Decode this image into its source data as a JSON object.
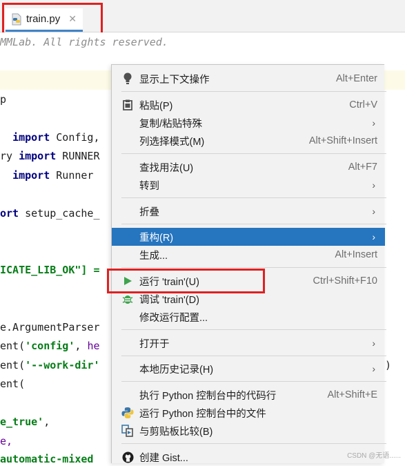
{
  "tab": {
    "filename": "train.py",
    "close_glyph": "✕"
  },
  "editor": {
    "lines": {
      "l1": "MMLab. All rights reserved.",
      "l3": "p",
      "l4a": "  ",
      "l4b": "import",
      "l4c": " Config,",
      "l5a": "ry ",
      "l5b": "import",
      "l5c": " RUNNER",
      "l6a": "  ",
      "l6b": "import",
      "l6c": " Runner",
      "l7a": "ort",
      "l7b": " setup_cache_",
      "l9": "ICATE_LIB_OK\"] =",
      "l11": "e.ArgumentParser",
      "l12a": "ent(",
      "l12b": "'config'",
      "l12c": ", ",
      "l12d": "he",
      "l13a": "ent(",
      "l13b": "'--work-dir'",
      "l13end": ")",
      "l14": "ent(",
      "l16a": "e_true'",
      "l16b": ",",
      "l17": "e,",
      "l18": "automatic-mixed"
    }
  },
  "menu": {
    "items": [
      {
        "label": "显示上下文操作",
        "shortcut": "Alt+Enter"
      },
      {
        "label": "粘贴(P)",
        "shortcut": "Ctrl+V"
      },
      {
        "label": "复制/粘贴特殊",
        "arrow": "›"
      },
      {
        "label": "列选择模式(M)",
        "shortcut": "Alt+Shift+Insert"
      },
      {
        "label": "查找用法(U)",
        "shortcut": "Alt+F7"
      },
      {
        "label": "转到",
        "arrow": "›"
      },
      {
        "label": "折叠",
        "arrow": "›"
      },
      {
        "label": "重构(R)",
        "arrow": "›"
      },
      {
        "label": "生成...",
        "shortcut": "Alt+Insert"
      },
      {
        "label": "运行 'train'(U)",
        "shortcut": "Ctrl+Shift+F10"
      },
      {
        "label": "调试 'train'(D)"
      },
      {
        "label": "修改运行配置..."
      },
      {
        "label": "打开于",
        "arrow": "›"
      },
      {
        "label": "本地历史记录(H)",
        "arrow": "›"
      },
      {
        "label": "执行 Python 控制台中的代码行",
        "shortcut": "Alt+Shift+E"
      },
      {
        "label": "运行 Python 控制台中的文件"
      },
      {
        "label": "与剪贴板比较(B)"
      },
      {
        "label": "创建 Gist..."
      }
    ],
    "active_item": "重构(R)"
  },
  "watermark": "CSDN @无语......",
  "colors": {
    "accent": "#2675bf",
    "highlight_box": "#e02020",
    "run_green": "#3fa34d"
  },
  "icons": [
    "python-file-icon",
    "bulb-icon",
    "clipboard-icon",
    "run-icon",
    "debug-icon",
    "python-console-icon",
    "compare-icon",
    "github-icon"
  ]
}
